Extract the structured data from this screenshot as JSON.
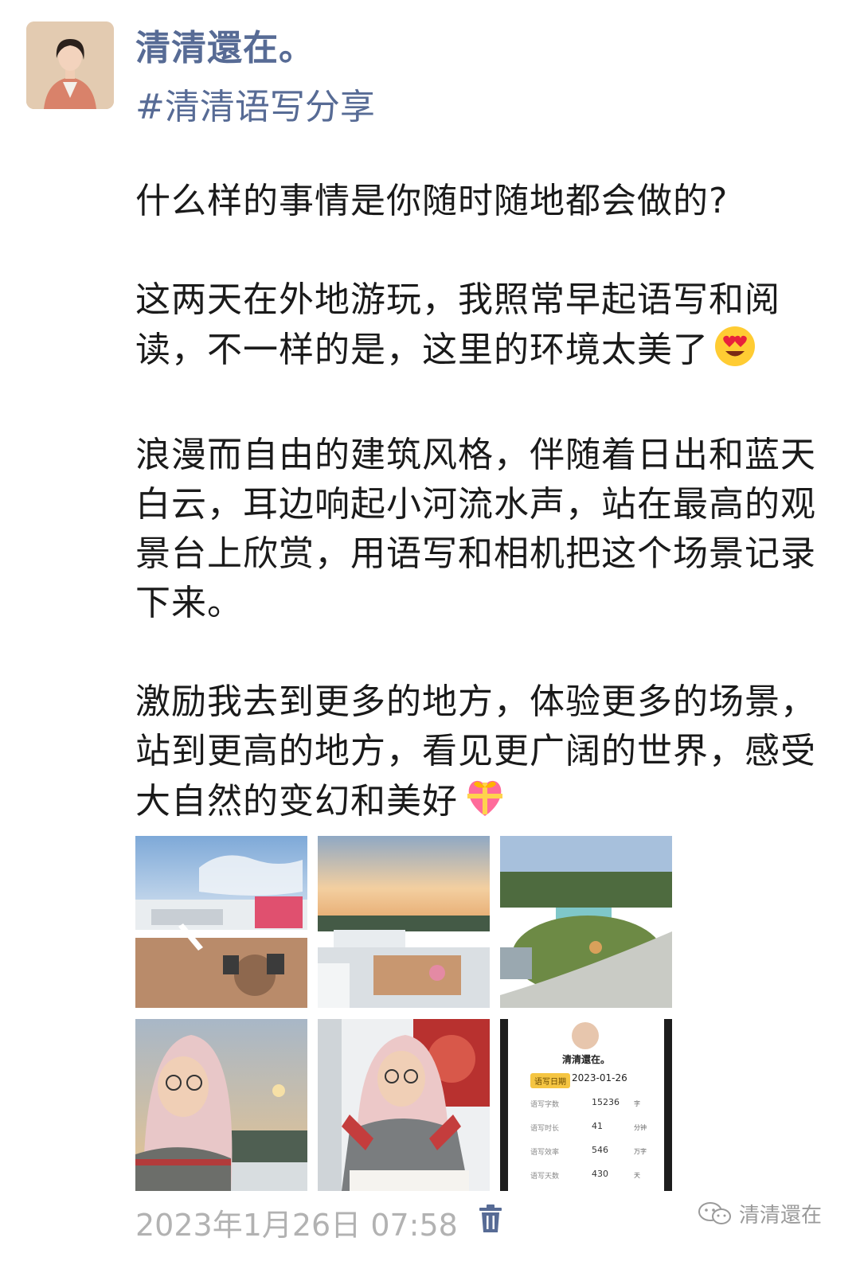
{
  "post": {
    "username": "清清還在。",
    "topic": "#清清语写分享",
    "paragraphs": [
      "什么样的事情是你随时随地都会做的?",
      "这两天在外地游玩，我照常早起语写和阅读，不一样的是，这里的环境太美了",
      "浪漫而自由的建筑风格，伴随着日出和蓝天白云，耳边响起小河流水声，站在最高的观景台上欣赏，用语写和相机把这个场景记录下来。",
      "激励我去到更多的地方，体验更多的场景，站到更高的地方，看见更广阔的世界，感受大自然的变幻和美好"
    ],
    "emojis": [
      "heart-eyes-emoji",
      "gift-heart-emoji"
    ],
    "timestamp": "2023年1月26日 07:58"
  },
  "photos": [
    {
      "name": "photo-rooftop-terrace"
    },
    {
      "name": "photo-sunset-rooftop"
    },
    {
      "name": "photo-garden-pool"
    },
    {
      "name": "photo-selfie-sunset"
    },
    {
      "name": "photo-selfie-blanket"
    },
    {
      "name": "photo-stats-screenshot"
    }
  ],
  "stats_card": {
    "name": "清清還在。",
    "badge": "语写日期",
    "date": "2023-01-26",
    "rows": [
      {
        "label": "语写字数",
        "value": "15236",
        "unit": "字"
      },
      {
        "label": "语写时长",
        "value": "41",
        "unit": "分钟"
      },
      {
        "label": "语写效率",
        "value": "546",
        "unit": "万字"
      },
      {
        "label": "语写天数",
        "value": "430",
        "unit": "天"
      }
    ]
  },
  "watermark": {
    "text": "清清還在"
  },
  "colors": {
    "link": "#576b95",
    "text": "#1a1a1a",
    "muted": "#b2b2b2",
    "badge": "#f5c542"
  }
}
